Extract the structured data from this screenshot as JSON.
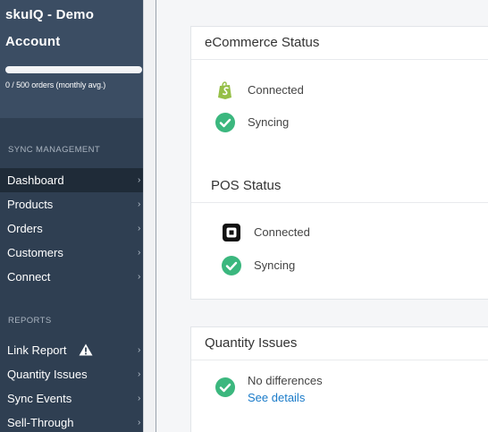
{
  "account": {
    "title": "skuIQ - Demo Account",
    "orders_usage": "0 / 500 orders (monthly avg.)",
    "usage_fraction": 0
  },
  "sidebar": {
    "sync_management": {
      "label": "SYNC MANAGEMENT",
      "items": [
        {
          "label": "Dashboard",
          "active": true
        },
        {
          "label": "Products"
        },
        {
          "label": "Orders"
        },
        {
          "label": "Customers"
        },
        {
          "label": "Connect"
        }
      ]
    },
    "reports": {
      "label": "REPORTS",
      "items": [
        {
          "label": "Link Report",
          "warning": true
        },
        {
          "label": "Quantity Issues"
        },
        {
          "label": "Sync Events"
        },
        {
          "label": "Sell-Through"
        }
      ]
    }
  },
  "ecommerce_status": {
    "title": "eCommerce Status",
    "connection": {
      "icon": "shopify-icon",
      "text": "Connected"
    },
    "sync": {
      "icon": "check-circle-icon",
      "text": "Syncing"
    }
  },
  "pos_status": {
    "title": "POS Status",
    "connection": {
      "icon": "square-pos-icon",
      "text": "Connected"
    },
    "sync": {
      "icon": "check-circle-icon",
      "text": "Syncing"
    }
  },
  "quantity_issues": {
    "title": "Quantity Issues",
    "status_text": "No differences",
    "link_text": "See details"
  },
  "colors": {
    "sidebar": "#2f3f52",
    "sidebar_header": "#3b4d63",
    "active_item": "#1f2b38",
    "success_green": "#3bb77e",
    "link_blue": "#1a7bc9",
    "shopify_green": "#95bf47"
  }
}
